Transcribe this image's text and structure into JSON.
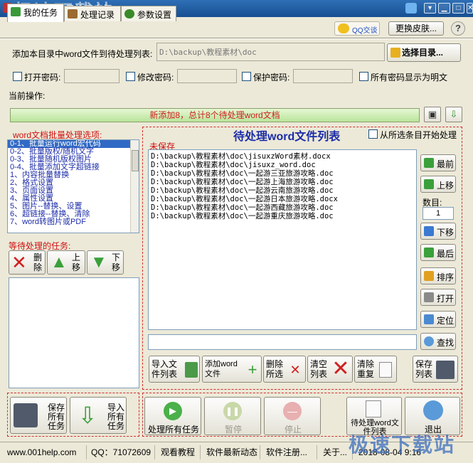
{
  "window": {
    "title": "word文档批量处理大师",
    "watermark": "极速下载站"
  },
  "tabs": [
    {
      "label": "我的任务"
    },
    {
      "label": "处理记录"
    },
    {
      "label": "参数设置"
    }
  ],
  "header": {
    "qq_label": "QQ交谈",
    "skin_label": "更换皮肤..."
  },
  "dir": {
    "label": "添加本目录中word文件到待处理列表:",
    "value": "D:\\backup\\教程素材\\doc",
    "select_label": "选择目录..."
  },
  "passwords": {
    "open_label": "打开密码:",
    "modify_label": "修改密码:",
    "protect_label": "保护密码:",
    "show_plain_label": "所有密码显示为明文"
  },
  "current_op": {
    "label": "当前操作:",
    "progress_text": "新添加8，总计8个待处理word文档"
  },
  "options": {
    "title": "word文档批量处理选项:",
    "items": [
      "0-1、批量运行word宏代码",
      "0-2、批量版权/随机文字",
      "0-3、批量随机版权图片",
      "0-4、批量添加文字超链接",
      "1、内容批量替换",
      "2、格式设置",
      "3、页面设置",
      "4、属性设置",
      "5、图片--替换、设置",
      "6、超链接--替换、清除",
      "7、word转图片或PDF"
    ]
  },
  "pending_tasks": {
    "title": "等待处理的任务:",
    "delete_label": "删除",
    "up_label": "上移",
    "down_label": "下移"
  },
  "file_list": {
    "title": "待处理word文件列表",
    "start_from_selected": "从所选条目开始处理",
    "unsaved": "未保存",
    "files": [
      "D:\\backup\\教程素材\\doc\\jisuxzWord素材.docx",
      "D:\\backup\\教程素材\\doc\\jisuxz_word.doc",
      "D:\\backup\\教程素材\\doc\\一起游三亚旅游攻略.doc",
      "D:\\backup\\教程素材\\doc\\一起游上海旅游攻略.doc",
      "D:\\backup\\教程素材\\doc\\一起游云南旅游攻略.doc",
      "D:\\backup\\教程素材\\doc\\一起游日本旅游攻略.docx",
      "D:\\backup\\教程素材\\doc\\一起游西藏旅游攻略.doc",
      "D:\\backup\\教程素材\\doc\\一起游重庆旅游攻略.doc"
    ]
  },
  "side_buttons": {
    "top": "最前",
    "up": "上移",
    "count_label": "数目:",
    "count_value": "1",
    "down": "下移",
    "bottom": "最后",
    "sort": "排序",
    "open": "打开",
    "locate": "定位",
    "find": "查找"
  },
  "list_actions": {
    "import": "导入文件列表",
    "add": "添加word文件",
    "delete_selected": "删除所选",
    "clear": "清空列表",
    "dedupe": "清除重复",
    "save": "保存列表"
  },
  "task_actions": {
    "save_all": "保存所有任务",
    "import_all": "导入所有任务"
  },
  "run_actions": {
    "process_all": "处理所有任务",
    "pause": "暂停",
    "stop": "停止",
    "pending_list": "待处理word文件列表",
    "exit": "退出"
  },
  "status": {
    "site": "www.001help.com",
    "qq": "QQ：71072609",
    "tutorial": "观看教程",
    "news": "软件最新动态",
    "register": "软件注册...",
    "about": "关于...",
    "datetime": "2018-08-04  9:16"
  },
  "colors": {
    "accent": "#1c2ca8",
    "alert": "#d01010",
    "title_bar": "#1f5ca3",
    "panel": "#ece9d8"
  }
}
